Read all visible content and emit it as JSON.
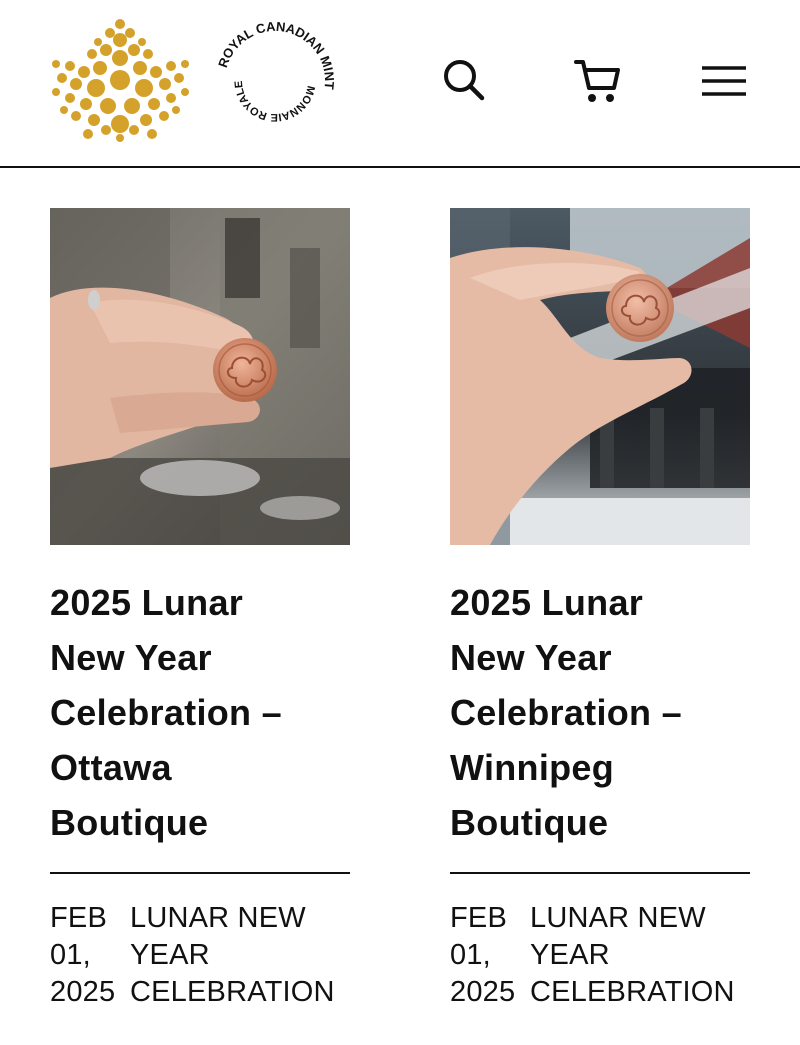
{
  "header": {
    "seal_text_outer": "ROYAL CANADIAN MINT",
    "seal_text_inner": "MONNAIE ROYALE CANADIENNE",
    "icons": {
      "logo": "maple-leaf-dots-icon",
      "search": "search-icon",
      "cart": "cart-icon",
      "menu": "hamburger-menu-icon"
    },
    "colors": {
      "logo_gold": "#D4A22A",
      "text": "#111111",
      "rule": "#111111"
    }
  },
  "cards": [
    {
      "title": "2025 Lunar\nNew Year\nCelebration –\nOttawa\nBoutique",
      "date": "FEB\n01,\n2025",
      "category": "LUNAR NEW\nYEAR\nCELEBRATION"
    },
    {
      "title": "2025 Lunar\nNew Year\nCelebration –\nWinnipeg\nBoutique",
      "date": "FEB\n01,\n2025",
      "category": "LUNAR NEW\nYEAR\nCELEBRATION"
    }
  ]
}
